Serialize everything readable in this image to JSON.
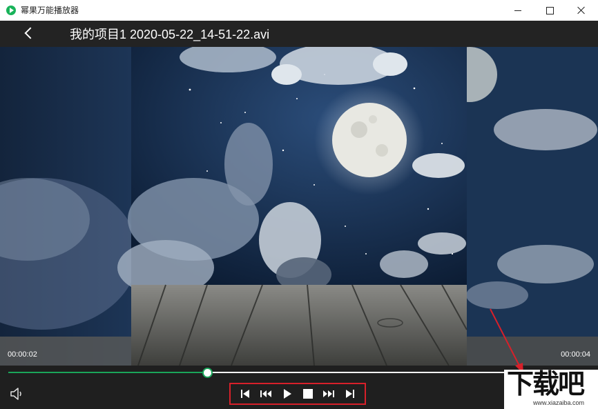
{
  "window": {
    "title": "幂果万能播放器",
    "accent_color": "#19b35a"
  },
  "header": {
    "file_title": "我的项目1 2020-05-22_14-51-22.avi"
  },
  "player": {
    "current_time": "00:00:02",
    "total_time": "00:00:04",
    "progress_percent": 34,
    "progress_color": "#1aa55a"
  },
  "controls": {
    "buttons": [
      "skip-to-start-icon",
      "rewind-icon",
      "play-icon",
      "stop-icon",
      "fast-forward-icon",
      "skip-to-end-icon"
    ],
    "highlight_color": "#d8202a"
  },
  "watermark": {
    "text": "下载吧",
    "url": "www.xiazaiba.com"
  }
}
